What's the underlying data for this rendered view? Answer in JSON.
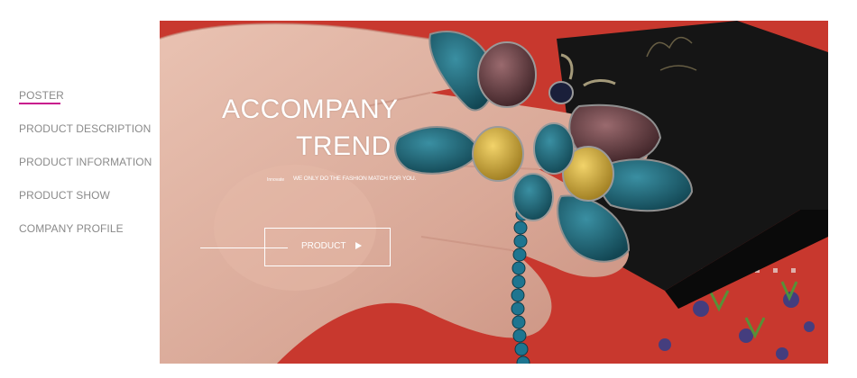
{
  "sidebar": {
    "items": [
      {
        "label": "POSTER",
        "active": true
      },
      {
        "label": "PRODUCT DESCRIPTION",
        "active": false
      },
      {
        "label": "PRODUCT INFORMATION",
        "active": false
      },
      {
        "label": "PRODUCT SHOW",
        "active": false
      },
      {
        "label": "COMPANY PROFILE",
        "active": false
      }
    ],
    "active_underline_color": "#c8148c"
  },
  "banner": {
    "headline_line1": "ACCOMPANY",
    "headline_line2": "TREND",
    "small_tag": "Innovate",
    "subline": "WE ONLY DO THE FASHION MATCH FOR YOU.",
    "button_label": "PRODUCT",
    "button_icon": "play-arrow-icon",
    "colors": {
      "fabric": "#c8382e",
      "box": "#141414",
      "gem_teal": "#1d5f70",
      "text": "#ffffff"
    }
  }
}
